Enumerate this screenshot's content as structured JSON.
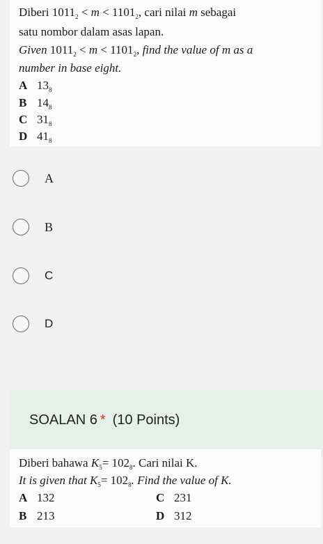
{
  "q5": {
    "malay_pre": "Diberi",
    "n1": "1011",
    "n1_base": "2",
    "lt1": "<",
    "var": "m",
    "lt2": "<",
    "n2": "1101",
    "n2_base": "2",
    "malay_post": ", cari nilai",
    "malay_var": "m",
    "malay_tail": "sebagai",
    "malay_line2": "satu nombor dalam asas lapan.",
    "eng_pre": "Given",
    "eng_post": "find the value of m as a",
    "eng_line2": "number in base eight.",
    "options": [
      {
        "letter": "A",
        "value": "13",
        "base": "8"
      },
      {
        "letter": "B",
        "value": "14",
        "base": "8"
      },
      {
        "letter": "C",
        "value": "31",
        "base": "8"
      },
      {
        "letter": "D",
        "value": "41",
        "base": "8"
      }
    ]
  },
  "choices": [
    "A",
    "B",
    "C",
    "D"
  ],
  "q6": {
    "title": "SOALAN 6",
    "required_mark": "*",
    "points": "(10 Points)",
    "malay_pre": "Diberi bahawa",
    "k": "K",
    "k_sub": "5",
    "eq": "= 102",
    "eq_sub": "8",
    "malay_post": ". Cari nilai K.",
    "eng_pre": "It is given that",
    "eng_post": ". Find the value of K.",
    "options": [
      {
        "letter": "A",
        "value": "132"
      },
      {
        "letter": "C",
        "value": "231"
      },
      {
        "letter": "B",
        "value": "213"
      },
      {
        "letter": "D",
        "value": "312"
      }
    ]
  }
}
